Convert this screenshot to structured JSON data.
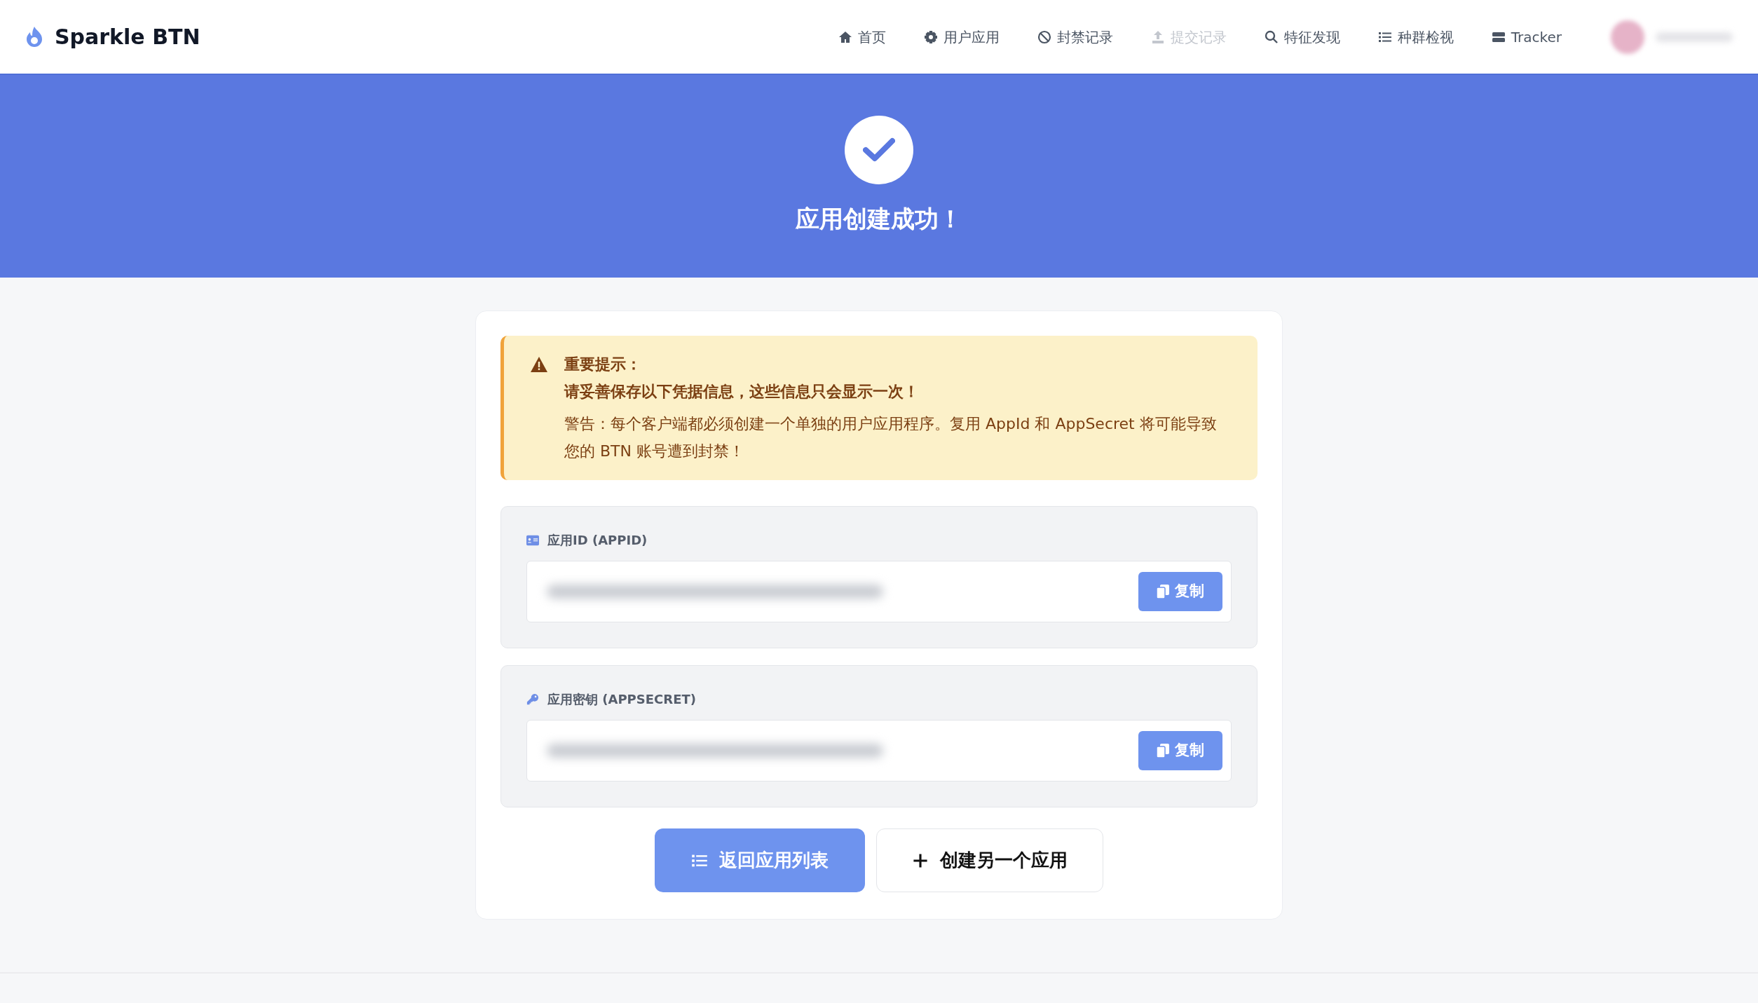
{
  "brand": "Sparkle BTN",
  "nav": [
    {
      "label": "首页",
      "disabled": false
    },
    {
      "label": "用户应用",
      "disabled": false
    },
    {
      "label": "封禁记录",
      "disabled": false
    },
    {
      "label": "提交记录",
      "disabled": true
    },
    {
      "label": "特征发现",
      "disabled": false
    },
    {
      "label": "种群检视",
      "disabled": false
    },
    {
      "label": "Tracker",
      "disabled": false
    }
  ],
  "hero": {
    "title": "应用创建成功！"
  },
  "alert": {
    "title": "重要提示：",
    "message": "请妥善保存以下凭据信息，这些信息只会显示一次！",
    "warning": "警告：每个客户端都必须创建一个单独的用户应用程序。复用 AppId 和 AppSecret 将可能导致您的 BTN 账号遭到封禁！"
  },
  "credentials": [
    {
      "label": "应用ID (APPID)",
      "button": "复制"
    },
    {
      "label": "应用密钥 (APPSECRET)",
      "button": "复制"
    }
  ],
  "actions": [
    {
      "kind": "primary",
      "label": "返回应用列表"
    },
    {
      "kind": "outline",
      "label": "创建另一个应用"
    }
  ]
}
